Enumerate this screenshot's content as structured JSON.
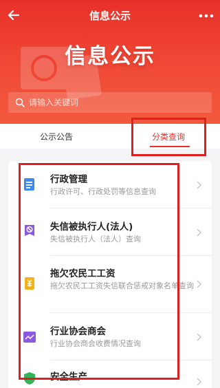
{
  "header": {
    "title": "信息公示",
    "back_icon": "back-arrow-icon",
    "more_icon": "more-dots-icon"
  },
  "hero": {
    "title": "信息公示"
  },
  "search": {
    "placeholder": "请输入关键词",
    "icon": "search-icon"
  },
  "tabs": [
    {
      "label": "公示公告",
      "active": false
    },
    {
      "label": "分类查询",
      "active": true
    }
  ],
  "items": [
    {
      "title": "行政管理",
      "desc": "行政许可、行政处罚等信息查询",
      "icon": "document-icon",
      "icon_color": "#3d8be8"
    },
    {
      "title": "失信被执行人(法人)",
      "desc": "失信被执行人（法人）查询",
      "icon": "ban-icon",
      "icon_color": "#8a59e0"
    },
    {
      "title": "拖欠农民工工资",
      "desc": "拖欠农民工工资失信联合惩戒对象名单查询",
      "icon": "wage-icon",
      "icon_color": "#f2b21c"
    },
    {
      "title": "行业协会商会",
      "desc": "行业协会商会收费情况查询",
      "icon": "chart-icon",
      "icon_color": "#8a59e0"
    },
    {
      "title": "安全生产",
      "desc": "",
      "icon": "shield-icon",
      "icon_color": "#35b35b"
    }
  ],
  "colors": {
    "brand_red": "#e8302a",
    "highlight_box": "#e01e20"
  }
}
